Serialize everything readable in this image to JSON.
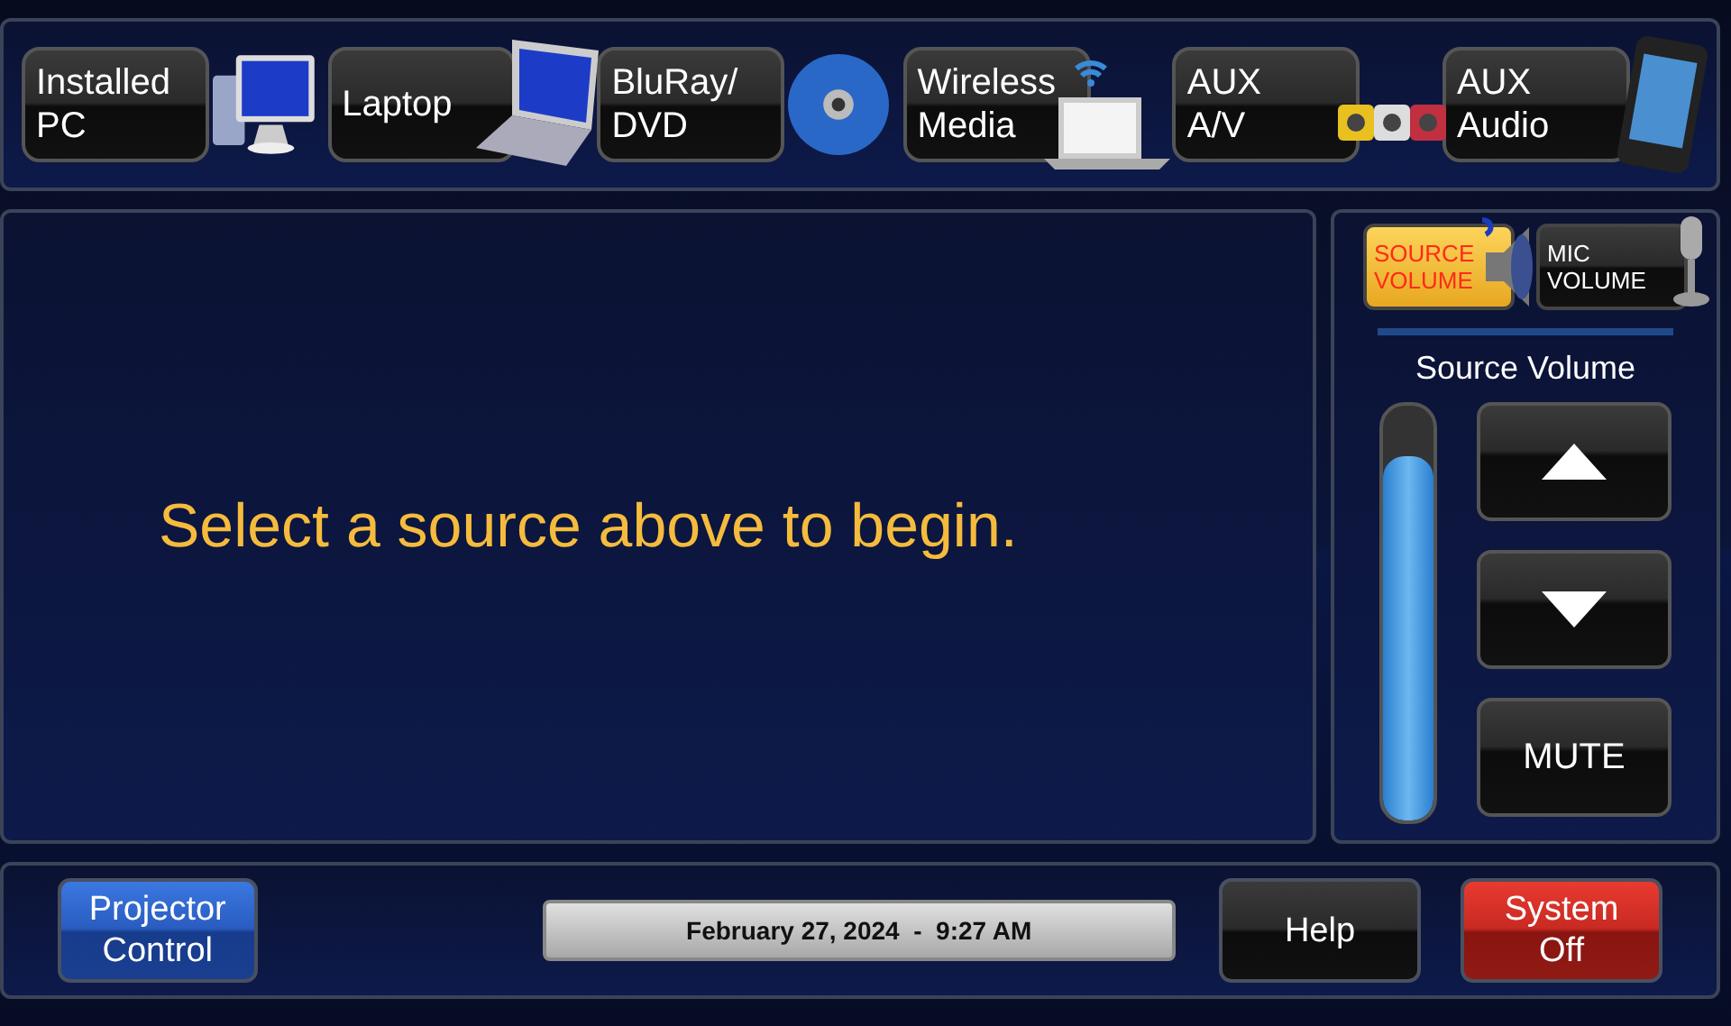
{
  "sources": [
    {
      "lines": [
        "Installed",
        "PC"
      ],
      "kind": "pc"
    },
    {
      "lines": [
        "Laptop"
      ],
      "kind": "laptop"
    },
    {
      "lines": [
        "BluRay/",
        "DVD"
      ],
      "kind": "disc"
    },
    {
      "lines": [
        "Wireless",
        "Media"
      ],
      "kind": "wireless"
    },
    {
      "lines": [
        "AUX",
        "A/V"
      ],
      "kind": "av"
    },
    {
      "lines": [
        "AUX",
        "Audio"
      ],
      "kind": "phone"
    }
  ],
  "message": "Select a source above to begin.",
  "volume_tabs": [
    {
      "lines": [
        "SOURCE",
        "VOLUME"
      ],
      "kind": "speaker",
      "selected": true
    },
    {
      "lines": [
        "MIC",
        "VOLUME"
      ],
      "kind": "mic",
      "selected": false
    }
  ],
  "volume": {
    "title": "Source Volume",
    "level": 0.88,
    "buttons": [
      {
        "kind": "up"
      },
      {
        "kind": "down"
      },
      {
        "kind": "text",
        "label": "MUTE"
      }
    ]
  },
  "footer": {
    "left": {
      "lines": [
        "Projector",
        "Control"
      ],
      "kind": "blue"
    },
    "datetime": "February 27, 2024  -  9:27 AM",
    "right": [
      {
        "lines": [
          "Help"
        ],
        "kind": "black"
      },
      {
        "lines": [
          "System",
          "Off"
        ],
        "kind": "red"
      }
    ]
  }
}
